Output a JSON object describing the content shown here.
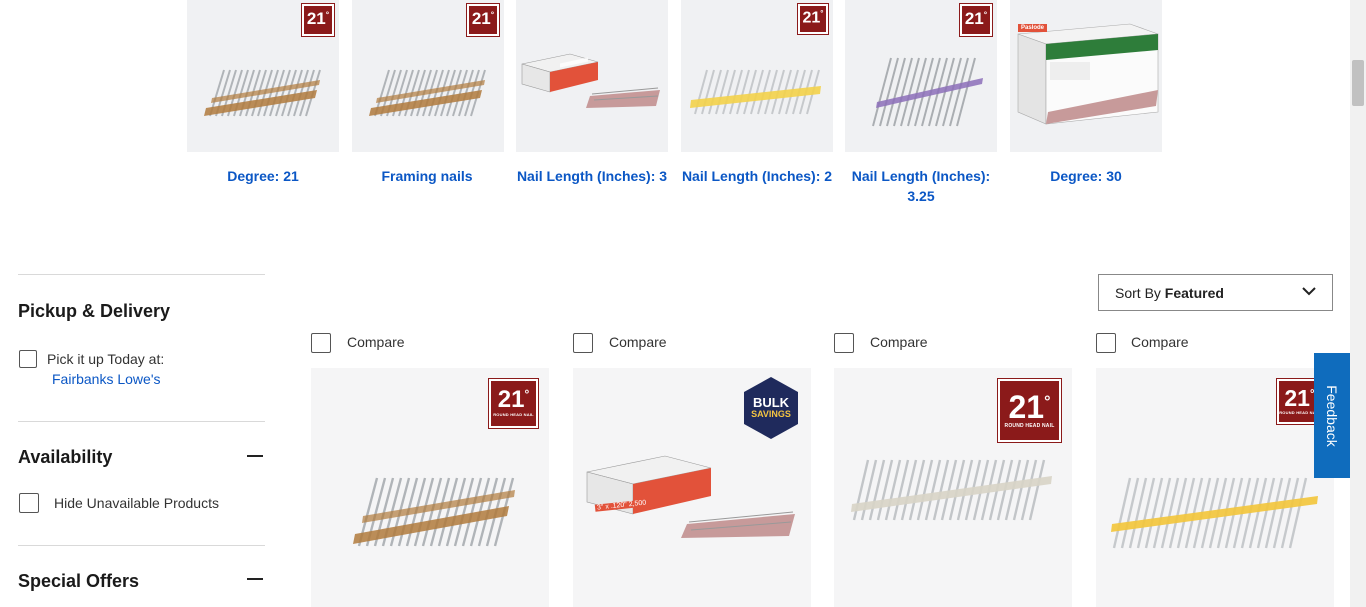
{
  "categories": [
    {
      "label": "Degree: 21",
      "badge": "21"
    },
    {
      "label": "Framing nails",
      "badge": "21"
    },
    {
      "label": "Nail Length (Inches): 3",
      "badge": ""
    },
    {
      "label": "Nail Length (Inches): 2",
      "badge": "21"
    },
    {
      "label": "Nail Length (Inches): 3.25",
      "badge": "21"
    },
    {
      "label": "Degree: 30",
      "badge": ""
    }
  ],
  "box_brand": "Paslode",
  "sidebar": {
    "pickup_heading": "Pickup & Delivery",
    "pickup_text": "Pick it up Today at:",
    "store_link": "Fairbanks Lowe's",
    "availability_heading": "Availability",
    "hide_unavailable": "Hide Unavailable Products",
    "special_offers_heading": "Special Offers"
  },
  "sort": {
    "prefix": "Sort By",
    "value": "Featured"
  },
  "compare_label": "Compare",
  "products": [
    {
      "badge": "21",
      "badge_sub": "ROUND HEAD NAIL"
    },
    {
      "bulk_line1": "BULK",
      "bulk_line2": "SAVINGS",
      "box_label": "3\" x .120\" 2,500"
    },
    {
      "badge": "21",
      "badge_sub": "ROUND HEAD NAIL"
    },
    {
      "badge": "21",
      "badge_sub": "ROUND HEAD NAIL"
    }
  ],
  "feedback_label": "Feedback",
  "colors": {
    "link": "#0b57c5",
    "badge_red": "#8b1a1a",
    "feedback_blue": "#0f6cbd",
    "bulk_navy": "#1f2a5c"
  }
}
